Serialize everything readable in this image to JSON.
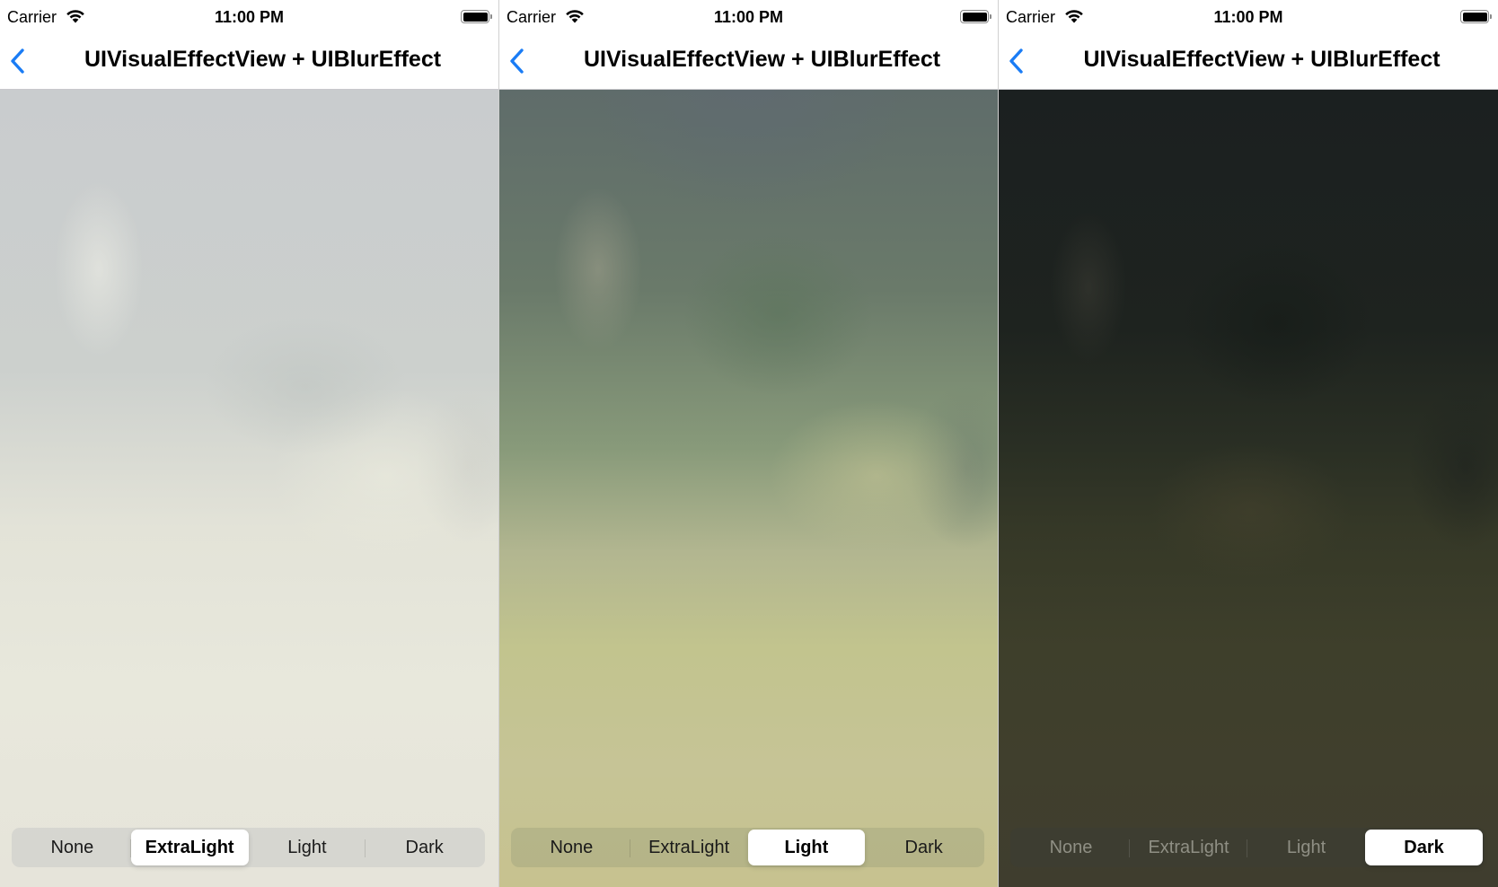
{
  "screens": [
    {
      "status": {
        "carrier": "Carrier",
        "time": "11:00 PM"
      },
      "nav": {
        "title": "UIVisualEffectView + UIBlurEffect"
      },
      "segments": [
        {
          "label": "None",
          "selected": false
        },
        {
          "label": "ExtraLight",
          "selected": true
        },
        {
          "label": "Light",
          "selected": false
        },
        {
          "label": "Dark",
          "selected": false
        }
      ]
    },
    {
      "status": {
        "carrier": "Carrier",
        "time": "11:00 PM"
      },
      "nav": {
        "title": "UIVisualEffectView + UIBlurEffect"
      },
      "segments": [
        {
          "label": "None",
          "selected": false
        },
        {
          "label": "ExtraLight",
          "selected": false
        },
        {
          "label": "Light",
          "selected": true
        },
        {
          "label": "Dark",
          "selected": false
        }
      ]
    },
    {
      "status": {
        "carrier": "Carrier",
        "time": "11:00 PM"
      },
      "nav": {
        "title": "UIVisualEffectView + UIBlurEffect"
      },
      "segments": [
        {
          "label": "None",
          "selected": false
        },
        {
          "label": "ExtraLight",
          "selected": false
        },
        {
          "label": "Light",
          "selected": false
        },
        {
          "label": "Dark",
          "selected": true
        }
      ]
    }
  ],
  "icons": {
    "back": "chevron-left-icon",
    "wifi": "wifi-icon",
    "battery": "battery-icon"
  },
  "colors": {
    "accent": "#1a7cf5"
  }
}
